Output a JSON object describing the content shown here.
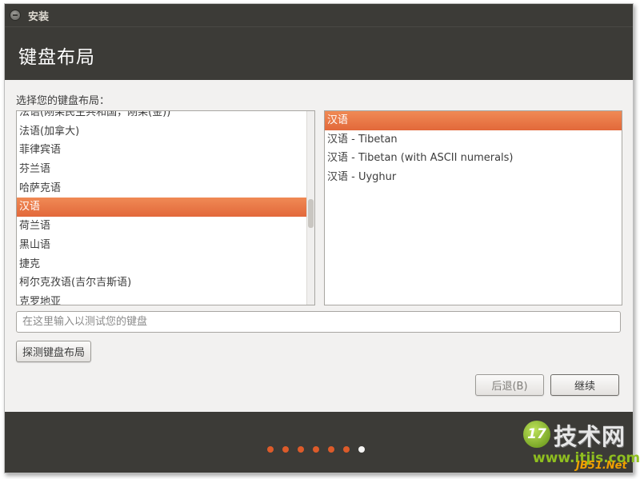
{
  "window": {
    "title": "安装"
  },
  "header": {
    "title": "键盘布局"
  },
  "prompt": "选择您的键盘布局：",
  "layouts": {
    "items": [
      "法语(刚果民主共和国，刚果(金))",
      "法语(加拿大)",
      "菲律宾语",
      "芬兰语",
      "哈萨克语",
      "汉语",
      "荷兰语",
      "黑山语",
      "捷克",
      "柯尔克孜语(吉尔吉斯语)",
      "克罗地亚"
    ],
    "selected_index": 5
  },
  "variants": {
    "items": [
      "汉语",
      "汉语 - Tibetan",
      "汉语 - Tibetan (with ASCII numerals)",
      "汉语 - Uyghur"
    ],
    "selected_index": 0
  },
  "test_input": {
    "value": "",
    "placeholder": "在这里输入以测试您的键盘"
  },
  "buttons": {
    "detect": "探测键盘布局",
    "back": "后退(B)",
    "continue": "继续"
  },
  "progress": {
    "total_steps": 7,
    "current_step": 7
  },
  "watermark": {
    "logo": "17",
    "name": "技术网",
    "url": "www.itjis.com",
    "tag": "JB51.Net"
  },
  "colors": {
    "accent": "#e2683a",
    "chrome": "#3c3b37",
    "progress_dot": "#dd5b2a"
  }
}
